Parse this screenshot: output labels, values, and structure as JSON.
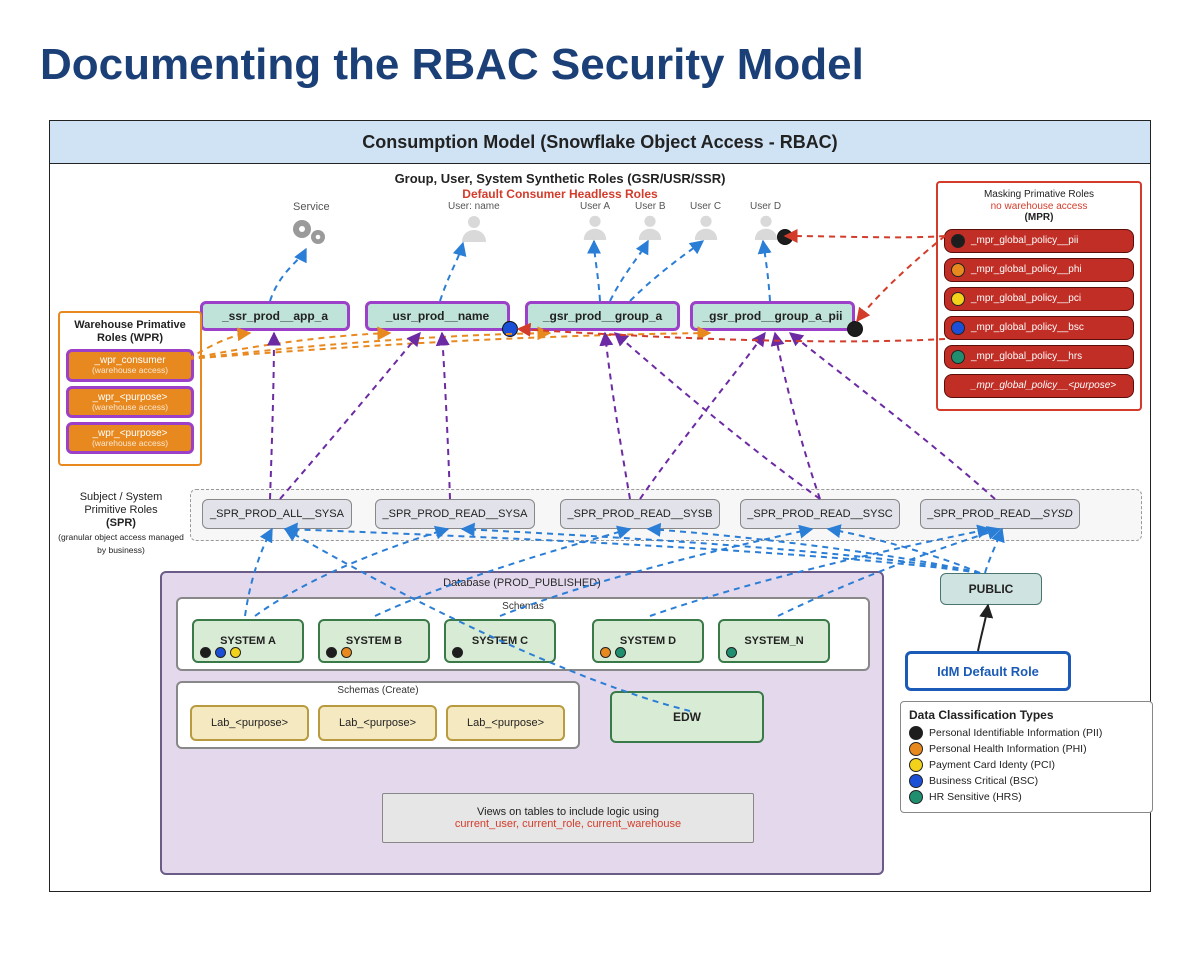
{
  "title": "Documenting the RBAC Security Model",
  "banner": "Consumption Model (Snowflake Object Access - RBAC)",
  "section": {
    "synthetic_title": "Group, User, System Synthetic Roles (GSR/USR/SSR)",
    "synthetic_sub": "Default Consumer Headless Roles",
    "service_label": "Service",
    "users": [
      "User: name",
      "User A",
      "User B",
      "User C",
      "User D"
    ]
  },
  "synthetic_roles": [
    "_ssr_prod__app_a",
    "_usr_prod__name",
    "_gsr_prod__group_a",
    "_gsr_prod__group_a_pii"
  ],
  "wpr": {
    "title_l1": "Warehouse Primative",
    "title_l2": "Roles",
    "title_l3": "(WPR)",
    "items": [
      {
        "name": "_wpr_consumer",
        "sub": "(warehouse access)"
      },
      {
        "name": "_wpr_<purpose>",
        "sub": "(warehouse access)"
      },
      {
        "name": "_wpr_<purpose>",
        "sub": "(warehouse access)"
      }
    ]
  },
  "mpr": {
    "title_l1": "Masking Primative Roles",
    "title_l2": "no warehouse access",
    "title_l3": "(MPR)",
    "items": [
      {
        "label": "_mpr_global_policy__pii",
        "color": "#1d1d1d"
      },
      {
        "label": "_mpr_global_policy__phi",
        "color": "#e8891f"
      },
      {
        "label": "_mpr_global_policy__pci",
        "color": "#f3d21b"
      },
      {
        "label": "_mpr_global_policy__bsc",
        "color": "#1b4fd6"
      },
      {
        "label": "_mpr_global_policy__hrs",
        "color": "#1f8f6f"
      },
      {
        "label": "_mpr_global_policy__<purpose>",
        "color": ""
      }
    ]
  },
  "spr": {
    "label_l1": "Subject / System",
    "label_l2": "Primitive Roles",
    "label_l3": "(SPR)",
    "label_l4": "(granular object access managed by business)",
    "items": [
      "_SPR_PROD_ALL__SYSA",
      "_SPR_PROD_READ__SYSA",
      "_SPR_PROD_READ__SYSB",
      "_SPR_PROD_READ__SYSC",
      "_SPR_PROD_READ__SYSD"
    ]
  },
  "db": {
    "title": "Database (PROD_PUBLISHED)",
    "schemas_title": "Schemas",
    "schemas": [
      "SYSTEM A",
      "SYSTEM B",
      "SYSTEM C",
      "SYSTEM D",
      "SYSTEM_N"
    ],
    "schema_dots": {
      "SYSTEM A": [
        "#1d1d1d",
        "#1b4fd6",
        "#f3d21b"
      ],
      "SYSTEM B": [
        "#1d1d1d",
        "#e8891f"
      ],
      "SYSTEM C": [
        "#1d1d1d"
      ],
      "SYSTEM D": [
        "#e8891f",
        "#1f8f6f"
      ],
      "SYSTEM_N": [
        "#1f8f6f"
      ]
    },
    "create_title": "Schemas (Create)",
    "labs": [
      "Lab_<purpose>",
      "Lab_<purpose>",
      "Lab_<purpose>"
    ],
    "edw": "EDW",
    "views_l1": "Views on tables to include logic using",
    "views_l2": "current_user, current_role, current_warehouse"
  },
  "public": "PUBLIC",
  "idm": "IdM Default Role",
  "classification": {
    "title": "Data Classification Types",
    "items": [
      {
        "label": "Personal Identifiable Information (PII)",
        "color": "#1d1d1d"
      },
      {
        "label": "Personal Health Information (PHI)",
        "color": "#e8891f"
      },
      {
        "label": "Payment Card Identy (PCI)",
        "color": "#f3d21b"
      },
      {
        "label": "Business Critical (BSC)",
        "color": "#1b4fd6"
      },
      {
        "label": "HR Sensitive (HRS)",
        "color": "#1f8f6f"
      }
    ]
  },
  "colors": {
    "orange": "#e8891f",
    "purple": "#6c2aa3",
    "blue": "#2b7ed6",
    "red": "#d33c2b"
  }
}
